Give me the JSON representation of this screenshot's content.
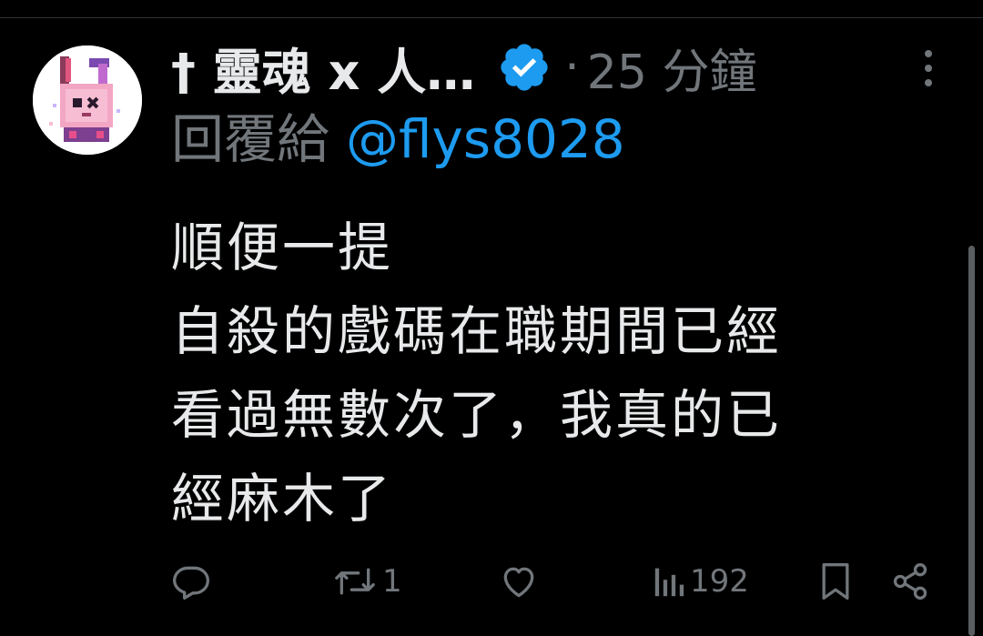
{
  "tweet": {
    "display_name": "† 靈魂 x 人…",
    "timestamp": "25 分鐘",
    "dot": "·",
    "reply_prefix": "回覆給",
    "reply_handle": "@flys8028",
    "text": "順便一提\n自殺的戲碼在職期間已經\n看過無數次了，我真的已\n經麻木了",
    "verified": true
  },
  "actions": {
    "reply_count": "",
    "repost_count": "1",
    "like_count": "",
    "views_count": "192"
  },
  "icons": {
    "avatar": "pixel-bunny-avatar",
    "verified": "verified-badge-icon",
    "more": "more-vertical-icon",
    "reply": "reply-icon",
    "repost": "repost-icon",
    "like": "heart-icon",
    "views": "views-icon",
    "bookmark": "bookmark-icon",
    "share": "share-icon"
  },
  "colors": {
    "background": "#000000",
    "text": "#e7e9ea",
    "muted": "#71767b",
    "accent": "#1d9bf0"
  }
}
